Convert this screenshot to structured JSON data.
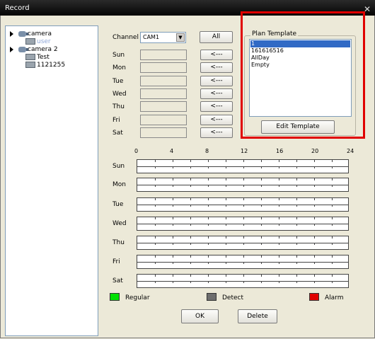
{
  "window": {
    "title": "Record",
    "close_glyph": "✕"
  },
  "tree": [
    {
      "label": "camera",
      "level": 0,
      "icon": "camera-icon",
      "expand": true
    },
    {
      "label": "user",
      "level": 1,
      "icon": "device-icon",
      "faded": true
    },
    {
      "label": "camera 2",
      "level": 0,
      "icon": "camera-icon",
      "expand": true
    },
    {
      "label": "Test",
      "level": 1,
      "icon": "device-icon"
    },
    {
      "label": "1121255",
      "level": 1,
      "icon": "device-icon"
    }
  ],
  "channel": {
    "label": "Channel",
    "value": "CAM1",
    "all_button": "All"
  },
  "days": [
    "Sun",
    "Mon",
    "Tue",
    "Wed",
    "Thu",
    "Fri",
    "Sat"
  ],
  "copy_button_label": "<---",
  "plan_template": {
    "label": "Plan Template",
    "items": [
      "1",
      "161616516",
      "AllDay",
      "Empty"
    ],
    "selected_index": 0,
    "edit_button": "Edit Template"
  },
  "hours": [
    "0",
    "4",
    "8",
    "12",
    "16",
    "20",
    "24"
  ],
  "legend": [
    {
      "label": "Regular",
      "color": "#00e000"
    },
    {
      "label": "Detect",
      "color": "#6e6e6e"
    },
    {
      "label": "Alarm",
      "color": "#e00000"
    }
  ],
  "buttons": {
    "ok": "OK",
    "delete": "Delete"
  },
  "highlight_color": "#e00000"
}
